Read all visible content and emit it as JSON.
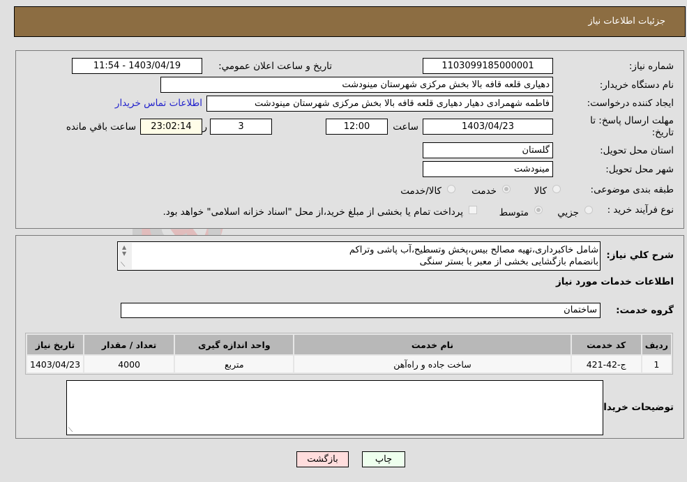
{
  "header": {
    "title": "جزئیات اطلاعات نیاز"
  },
  "form": {
    "need_number": {
      "label": "شماره نیاز:",
      "value": "1103099185000001"
    },
    "announce": {
      "label": "تاریخ و ساعت اعلان عمومي:",
      "value": "1403/04/19 - 11:54"
    },
    "buyer_org": {
      "label": "نام دستگاه خریدار:",
      "value": "دهیاری قلعه قافه بالا بخش مرکزی شهرستان مینودشت"
    },
    "requester": {
      "label": "ایجاد کننده درخواست:",
      "value": "فاطمه شهمرادی دهیار دهیاری قلعه قافه بالا بخش مرکزی شهرستان مینودشت"
    },
    "contact_link": "اطلاعات تماس خریدار",
    "deadline": {
      "label": "مهلت ارسال پاسخ: تا تاریخ:",
      "date": "1403/04/23",
      "time_label": "ساعت",
      "time": "12:00",
      "days": "3",
      "days_label": "روز و",
      "remaining": "23:02:14",
      "remaining_label": "ساعت باقي مانده"
    },
    "province": {
      "label": "استان محل تحویل:",
      "value": "گلستان"
    },
    "city": {
      "label": "شهر محل تحویل:",
      "value": "مینودشت"
    },
    "category": {
      "label": "طبقه بندی موضوعی:",
      "options": [
        {
          "label": "کالا",
          "selected": false
        },
        {
          "label": "خدمت",
          "selected": true
        },
        {
          "label": "کالا/خدمت",
          "selected": false
        }
      ]
    },
    "process": {
      "label": "نوع فرآیند خرید :",
      "options": [
        {
          "label": "جزيي",
          "selected": false
        },
        {
          "label": "متوسط",
          "selected": true
        }
      ],
      "treasury_text": "پرداخت تمام یا بخشی از مبلغ خرید،از محل \"اسناد خزانه اسلامی\" خواهد بود.",
      "treasury_checked": false
    }
  },
  "description": {
    "label": "شرح کلي نیاز:",
    "line1": "شامل خاکبرداری،تهیه مصالح بیس،پخش وتسطیح،آب پاشی وتراکم",
    "line2": "بانضمام بازگشایی بخشی از معبر با بستر سنگی"
  },
  "services": {
    "section_title": "اطلاعات خدمات مورد نیاز",
    "group_label": "گروه خدمت:",
    "group_value": "ساختمان",
    "table": {
      "headers": [
        "ردیف",
        "کد خدمت",
        "نام خدمت",
        "واحد اندازه گیری",
        "تعداد / مقدار",
        "تاریخ نیاز"
      ],
      "rows": [
        [
          "1",
          "ج-42-421",
          "ساخت جاده و راه‌آهن",
          "متربع",
          "4000",
          "1403/04/23"
        ]
      ]
    }
  },
  "buyer_notes": {
    "label": "توضیحات خریدار:",
    "value": ""
  },
  "buttons": {
    "print": "چاپ",
    "back": "بازگشت"
  },
  "colors": {
    "header_bg": "#8c6d42",
    "print_bg": "#eeffee",
    "back_bg": "#ffdddd",
    "link": "#2222cc"
  }
}
